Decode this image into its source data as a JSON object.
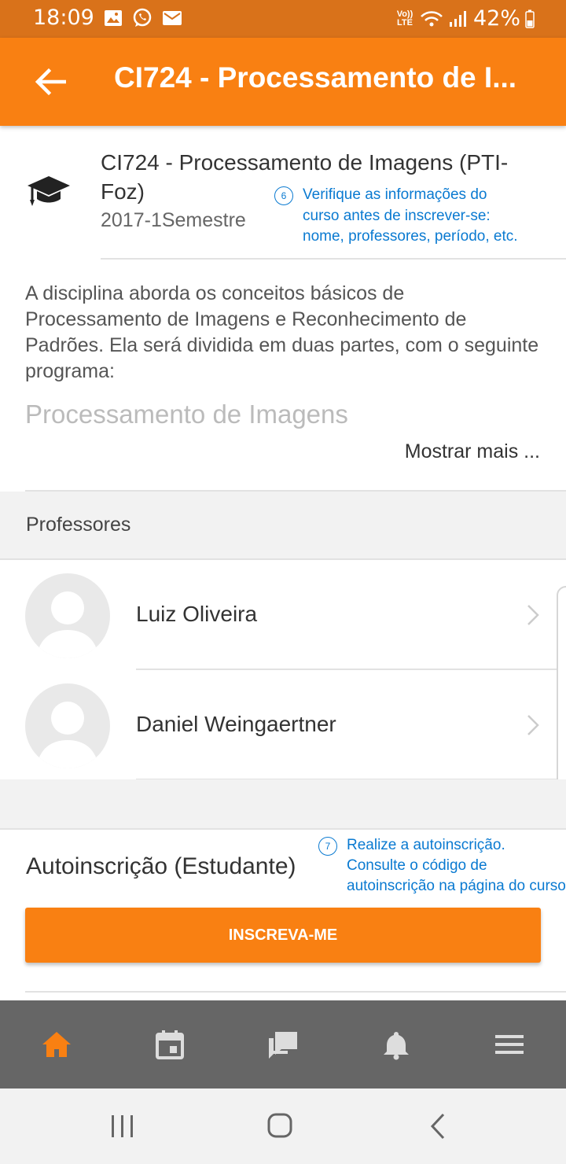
{
  "status_bar": {
    "time": "18:09",
    "network": "Vo)) LTE",
    "battery": "42%"
  },
  "app_bar": {
    "title": "CI724 - Processamento de I..."
  },
  "course": {
    "name": "CI724 - Processamento de Imagens (PTI-Foz)",
    "period": "2017-1Semestre",
    "summary": "A disciplina aborda os conceitos básicos de Processamento de Imagens e Reconhecimento de Padrões. Ela será dividida em duas partes, com o seguinte programa:",
    "summary_heading": "Processamento de Imagens",
    "show_more": "Mostrar mais ..."
  },
  "annotations": {
    "a6": {
      "number": "6",
      "lines": [
        "Verifique as informações do",
        "curso antes de inscrever-se:",
        "nome, professores, período, etc."
      ]
    },
    "a7": {
      "number": "7",
      "lines": [
        "Realize a autoinscrição.",
        "Consulte o código de",
        "autoinscrição na página do curso."
      ]
    }
  },
  "teachers": {
    "label": "Professores",
    "items": [
      {
        "name": "Luiz Oliveira"
      },
      {
        "name": "Daniel Weingaertner"
      }
    ]
  },
  "enrolment": {
    "title": "Autoinscrição (Estudante)",
    "button": "INSCREVA-ME"
  },
  "bottom_nav": {
    "items": [
      {
        "icon": "home-icon",
        "active": true
      },
      {
        "icon": "calendar-icon",
        "active": false
      },
      {
        "icon": "messages-icon",
        "active": false
      },
      {
        "icon": "notifications-icon",
        "active": false
      },
      {
        "icon": "menu-icon",
        "active": false
      }
    ]
  },
  "colors": {
    "brand": "#f98012",
    "status_bar": "#d9721a",
    "annotation": "#0a7ad1",
    "nav_bg": "#666666"
  }
}
